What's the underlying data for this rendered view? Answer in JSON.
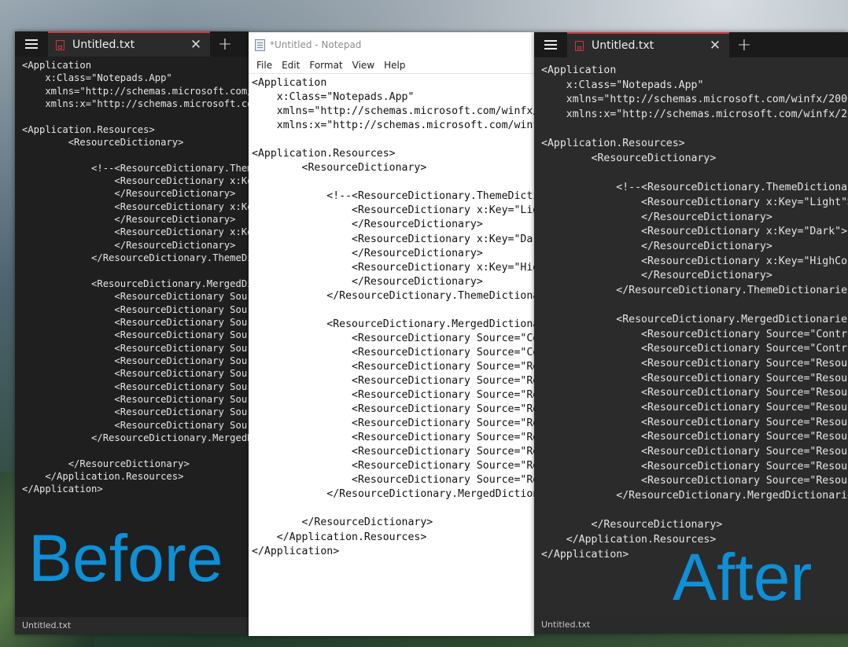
{
  "code_text": "<Application\n    x:Class=\"Notepads.App\"\n    xmlns=\"http://schemas.microsoft.com/winfx/2006/xaml/presentation\"\n    xmlns:x=\"http://schemas.microsoft.com/winfx/2006/xaml\">\n\n<Application.Resources>\n        <ResourceDictionary>\n\n            <!--<ResourceDictionary.ThemeDictionaries>\n                <ResourceDictionary x:Key=\"Light\">\n                </ResourceDictionary>\n                <ResourceDictionary x:Key=\"Dark\">\n                </ResourceDictionary>\n                <ResourceDictionary x:Key=\"HighContrast\">\n                </ResourceDictionary>\n            </ResourceDictionary.ThemeDictionaries>\n\n            <ResourceDictionary.MergedDictionaries>\n                <ResourceDictionary Source=\"Controls/\n                <ResourceDictionary Source=\"Controls/\n                <ResourceDictionary Source=\"Resources/\n                <ResourceDictionary Source=\"Resources/\n                <ResourceDictionary Source=\"Resources/\n                <ResourceDictionary Source=\"Resources/\n                <ResourceDictionary Source=\"Resources/\n                <ResourceDictionary Source=\"Resources/\n                <ResourceDictionary Source=\"Resources/\n                <ResourceDictionary Source=\"Resources/\n                <ResourceDictionary Source=\"Resources/\n            </ResourceDictionary.MergedDictionaries>\n\n        </ResourceDictionary>\n    </Application.Resources>\n</Application>",
  "before_window": {
    "tab_title": "Untitled.txt",
    "close_icon": "✕",
    "new_tab_icon": "+",
    "status_text": "Untitled.txt"
  },
  "notepad_window": {
    "title": "*Untitled - Notepad",
    "menu": [
      "File",
      "Edit",
      "Format",
      "View",
      "Help"
    ]
  },
  "after_window": {
    "tab_title": "Untitled.txt",
    "close_icon": "✕",
    "new_tab_icon": "+",
    "status_text": "Untitled.txt"
  },
  "labels": {
    "before": "Before",
    "after": "After"
  },
  "colors": {
    "accent": "#c43c44",
    "label_blue": "#0e8fd6"
  }
}
